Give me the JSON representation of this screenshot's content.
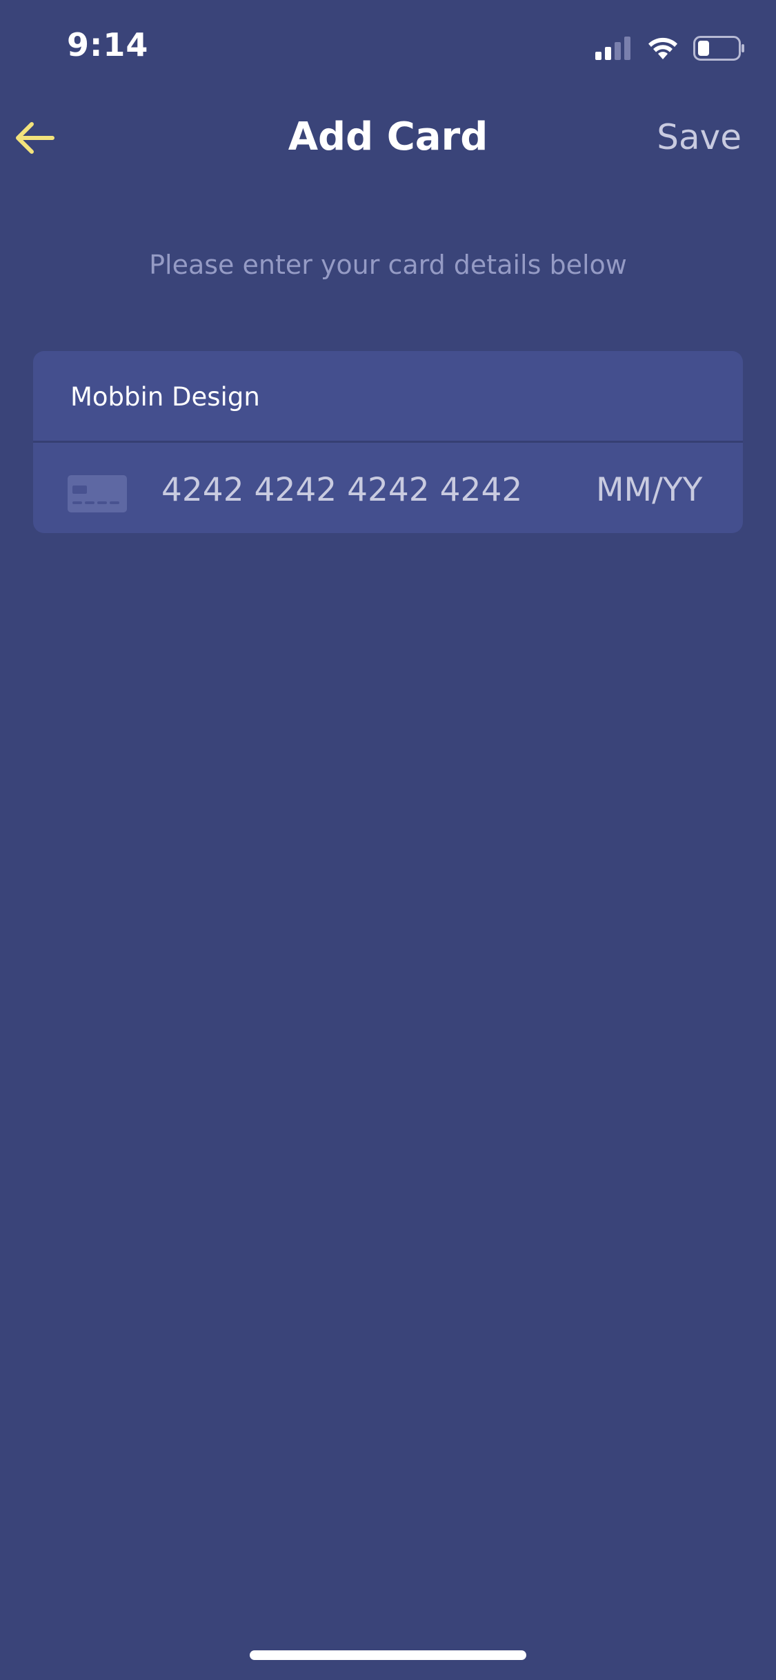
{
  "status_bar": {
    "time": "9:14",
    "icons": [
      "cellular-signal-icon",
      "wifi-icon",
      "battery-icon"
    ]
  },
  "nav": {
    "back_icon": "arrow-left-icon",
    "title": "Add Card",
    "save_label": "Save"
  },
  "instruction": "Please enter your card details below",
  "card_form": {
    "cardholder_name": "Mobbin Design",
    "card_icon": "credit-card-icon",
    "card_number_placeholder": "4242 4242 4242 4242",
    "expiry_placeholder": "MM/YY"
  },
  "colors": {
    "background": "#3a4479",
    "form_background": "#444f8e",
    "accent": "#f3e37c",
    "muted_text": "#959bc5",
    "light_text": "#c9cbe0"
  }
}
